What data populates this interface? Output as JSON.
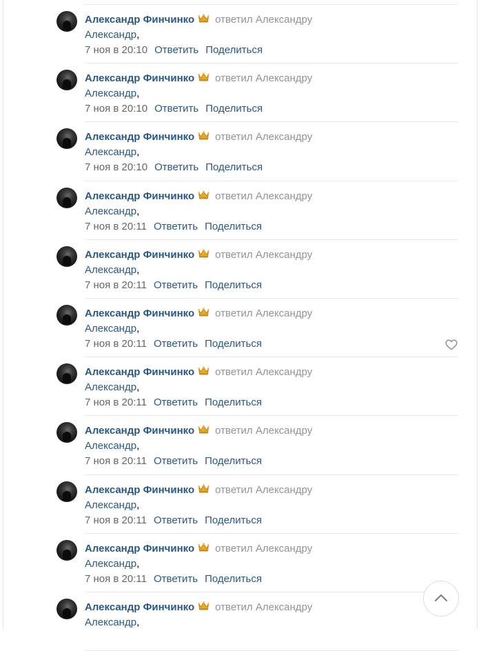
{
  "comments": [
    {
      "author": "Александр Финчинко",
      "reply_text": "ответил",
      "reply_target": "Александру",
      "addressee": "Александр",
      "comma": ",",
      "time": "7 ноя в 20:10",
      "reply_action": "Ответить",
      "share_action": "Поделиться"
    },
    {
      "author": "Александр Финчинко",
      "reply_text": "ответил",
      "reply_target": "Александру",
      "addressee": "Александр",
      "comma": ",",
      "time": "7 ноя в 20:10",
      "reply_action": "Ответить",
      "share_action": "Поделиться"
    },
    {
      "author": "Александр Финчинко",
      "reply_text": "ответил",
      "reply_target": "Александру",
      "addressee": "Александр",
      "comma": ",",
      "time": "7 ноя в 20:10",
      "reply_action": "Ответить",
      "share_action": "Поделиться"
    },
    {
      "author": "Александр Финчинко",
      "reply_text": "ответил",
      "reply_target": "Александру",
      "addressee": "Александр",
      "comma": ",",
      "time": "7 ноя в 20:11",
      "reply_action": "Ответить",
      "share_action": "Поделиться"
    },
    {
      "author": "Александр Финчинко",
      "reply_text": "ответил",
      "reply_target": "Александру",
      "addressee": "Александр",
      "comma": ",",
      "time": "7 ноя в 20:11",
      "reply_action": "Ответить",
      "share_action": "Поделиться"
    },
    {
      "author": "Александр Финчинко",
      "reply_text": "ответил",
      "reply_target": "Александру",
      "addressee": "Александр",
      "comma": ",",
      "time": "7 ноя в 20:11",
      "reply_action": "Ответить",
      "share_action": "Поделиться",
      "like_icon": "heart-outline-icon"
    },
    {
      "author": "Александр Финчинко",
      "reply_text": "ответил",
      "reply_target": "Александру",
      "addressee": "Александр",
      "comma": ",",
      "time": "7 ноя в 20:11",
      "reply_action": "Ответить",
      "share_action": "Поделиться"
    },
    {
      "author": "Александр Финчинко",
      "reply_text": "ответил",
      "reply_target": "Александру",
      "addressee": "Александр",
      "comma": ",",
      "time": "7 ноя в 20:11",
      "reply_action": "Ответить",
      "share_action": "Поделиться"
    },
    {
      "author": "Александр Финчинко",
      "reply_text": "ответил",
      "reply_target": "Александру",
      "addressee": "Александр",
      "comma": ",",
      "time": "7 ноя в 20:11",
      "reply_action": "Ответить",
      "share_action": "Поделиться"
    },
    {
      "author": "Александр Финчинко",
      "reply_text": "ответил",
      "reply_target": "Александру",
      "addressee": "Александр",
      "comma": ",",
      "time": "7 ноя в 20:11",
      "reply_action": "Ответить",
      "share_action": "Поделиться"
    },
    {
      "author": "Александр Финчинко",
      "reply_text": "ответил",
      "reply_target": "Александру",
      "addressee": "Александр",
      "comma": ",",
      "time": "",
      "reply_action": "",
      "share_action": ""
    }
  ],
  "icons": {
    "author_badge": "crown-icon",
    "like": "heart-outline-icon",
    "scroll_up": "chevron-up-icon"
  },
  "colors": {
    "link": "#2a5885",
    "muted": "#939393",
    "timestamp": "#656565",
    "divider": "#e7e8ec"
  }
}
